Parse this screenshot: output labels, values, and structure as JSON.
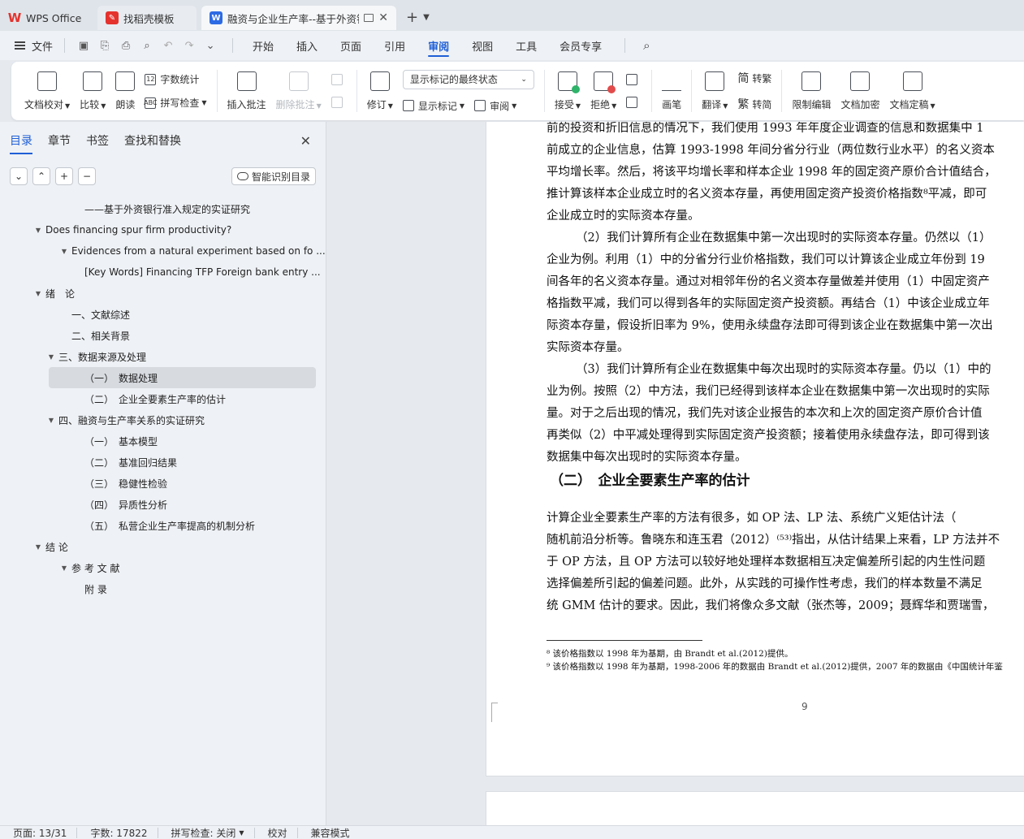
{
  "tabs": {
    "wps": "WPS Office",
    "template": "找稻壳模板",
    "document": "融资与企业生产率--基于外资银"
  },
  "menu": {
    "file": "文件",
    "tabs": [
      "开始",
      "插入",
      "页面",
      "引用",
      "审阅",
      "视图",
      "工具",
      "会员专享"
    ],
    "active": "审阅"
  },
  "ribbon": {
    "doc_check": "文档校对",
    "compare": "比较",
    "read_aloud": "朗读",
    "word_count": "字数统计",
    "spell_check": "拼写检查",
    "insert_comment": "插入批注",
    "delete_comment": "删除批注",
    "revise": "修订",
    "markup_select": "显示标记的最终状态",
    "show_markup": "显示标记",
    "review": "审阅",
    "accept": "接受",
    "reject": "拒绝",
    "ink": "画笔",
    "translate": "翻译",
    "to_traditional": "转繁",
    "to_simplified": "转简",
    "restrict_edit": "限制编辑",
    "encrypt": "文档加密",
    "finalize": "文档定稿"
  },
  "leftpane": {
    "tabs": [
      "目录",
      "章节",
      "书签",
      "查找和替换"
    ],
    "active": "目录",
    "ai_toc": "智能识别目录",
    "toc": [
      {
        "text": "——基于外资银行准入规定的实证研究",
        "level": 3,
        "arrow": ""
      },
      {
        "text": "Does financing spur firm productivity?",
        "level": 1,
        "arrow": "▼"
      },
      {
        "text": "Evidences from a natural experiment based on fo ...",
        "level": 2,
        "arrow": "▼"
      },
      {
        "text": "[Key Words] Financing TFP Foreign bank entry ...",
        "level": 3,
        "arrow": ""
      },
      {
        "text": "绪　论",
        "level": 1,
        "arrow": "▼"
      },
      {
        "text": "一、文献综述",
        "level": 2,
        "arrow": ""
      },
      {
        "text": "二、相关背景",
        "level": 2,
        "arrow": ""
      },
      {
        "text": "三、数据来源及处理",
        "level": 1.5,
        "arrow": "▼"
      },
      {
        "text": "（一）　数据处理",
        "level": 3,
        "arrow": "",
        "selected": true
      },
      {
        "text": "（二）　企业全要素生产率的估计",
        "level": 3,
        "arrow": ""
      },
      {
        "text": "四、融资与生产率关系的实证研究",
        "level": 1.5,
        "arrow": "▼"
      },
      {
        "text": "（一）　基本模型",
        "level": 3,
        "arrow": ""
      },
      {
        "text": "（二）　基准回归结果",
        "level": 3,
        "arrow": ""
      },
      {
        "text": "（三）　稳健性检验",
        "level": 3,
        "arrow": ""
      },
      {
        "text": "（四）　异质性分析",
        "level": 3,
        "arrow": ""
      },
      {
        "text": "（五）　私营企业生产率提高的机制分析",
        "level": 3,
        "arrow": ""
      },
      {
        "text": "结 论",
        "level": 1,
        "arrow": "▼"
      },
      {
        "text": "参 考 文 献",
        "level": 2,
        "arrow": "▼"
      },
      {
        "text": "附 录",
        "level": 3,
        "arrow": ""
      }
    ]
  },
  "document": {
    "para1": [
      "前的投资和折旧信息的情况下，我们使用  1993 年年度企业调查的信息和数据集中  1",
      "前成立的企业信息，估算 1993-1998 年间分省分行业（两位数行业水平）的名义资本",
      "平均增长率。然后，将该平均增长率和样本企业  1998 年的固定资产原价合计值结合，",
      "推计算该样本企业成立时的名义资本存量，再使用固定资产投资价格指数⁸平减，即可",
      "企业成立时的实际资本存量。"
    ],
    "para2": [
      "（2）我们计算所有企业在数据集中第一次出现时的实际资本存量。仍然以（1）",
      "企业为例。利用（1）中的分省分行业价格指数，我们可以计算该企业成立年份到  19",
      "间各年的名义资本存量。通过对相邻年份的名义资本存量做差并使用（1）中固定资产",
      "格指数平减，我们可以得到各年的实际固定资产投资额。再结合（1）中该企业成立年",
      "际资本存量，假设折旧率为  9%，使用永续盘存法即可得到该企业在数据集中第一次出",
      "实际资本存量。"
    ],
    "para3": [
      "（3）我们计算所有企业在数据集中每次出现时的实际资本存量。仍以（1）中的",
      "业为例。按照（2）中方法，我们已经得到该样本企业在数据集中第一次出现时的实际",
      "量。对于之后出现的情况，我们先对该企业报告的本次和上次的固定资产原价合计值",
      "再类似（2）中平减处理得到实际固定资产投资额；接着使用永续盘存法，即可得到该",
      "数据集中每次出现时的实际资本存量。"
    ],
    "heading": "（二）　企业全要素生产率的估计",
    "para4": [
      "计算企业全要素生产率的方法有很多，如  OP 法、LP 法、系统广义矩估计法（",
      "随机前沿分析等。鲁晓东和连玉君（2012）⁽⁵³⁾指出，从估计结果上来看，LP 方法并不",
      "于  OP 方法，且  OP 方法可以较好地处理样本数据相互决定偏差所引起的内生性问题",
      "选择偏差所引起的偏差问题。此外，从实践的可操作性考虑，我们的样本数量不满足",
      "统 GMM 估计的要求。因此，我们将像众多文献（张杰等，2009；聂辉华和贾瑞雪，"
    ],
    "footnotes": [
      "⁸ 该价格指数以  1998 年为基期，由  Brandt et al.(2012)提供。",
      "⁹ 该价格指数以  1998 年为基期，1998-2006 年的数据由  Brandt et al.(2012)提供，2007 年的数据由《中国统计年鉴"
    ],
    "page_number": "9"
  },
  "status": {
    "page": "页面: 13/31",
    "words": "字数: 17822",
    "spell": "拼写检查: 关闭",
    "proof": "校对",
    "compat": "兼容模式"
  }
}
